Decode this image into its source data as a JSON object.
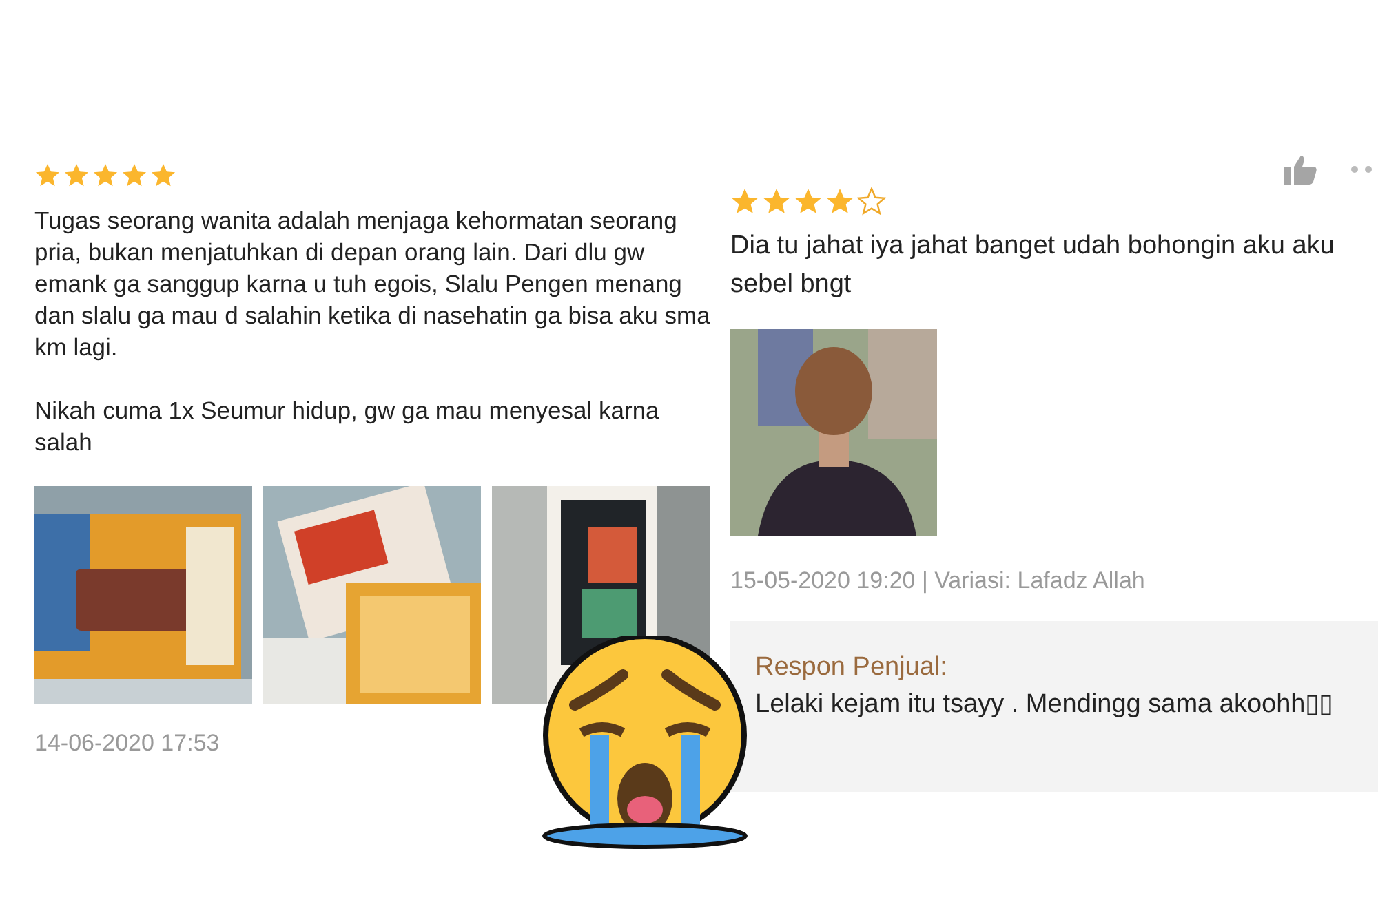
{
  "reviews": [
    {
      "stars": 5,
      "text": "Tugas seorang wanita adalah menjaga kehormatan seorang pria, bukan menjatuhkan di depan orang lain. Dari dlu gw emank ga sanggup karna u tuh egois, Slalu Pengen menang dan slalu ga mau d salahin ketika di nasehatin ga bisa aku sma km lagi.\n\nNikah cuma 1x Seumur hidup, gw ga mau menyesal karna salah",
      "photos": [
        {
          "kind": "picture"
        },
        {
          "kind": "picture"
        },
        {
          "kind": "picture"
        }
      ],
      "meta": "14-06-2020 17:53"
    },
    {
      "stars": 4,
      "text": "Dia tu jahat iya jahat banget udah bohongin aku aku sebel bngt",
      "photos": [
        {
          "kind": "picture"
        }
      ],
      "meta": "15-05-2020 19:20 | Variasi: Lafadz Allah",
      "reply": {
        "label": "Respon Penjual:",
        "text": "Lelaki kejam itu tsayy . Mendingg sama akoohh▯▯"
      }
    }
  ]
}
